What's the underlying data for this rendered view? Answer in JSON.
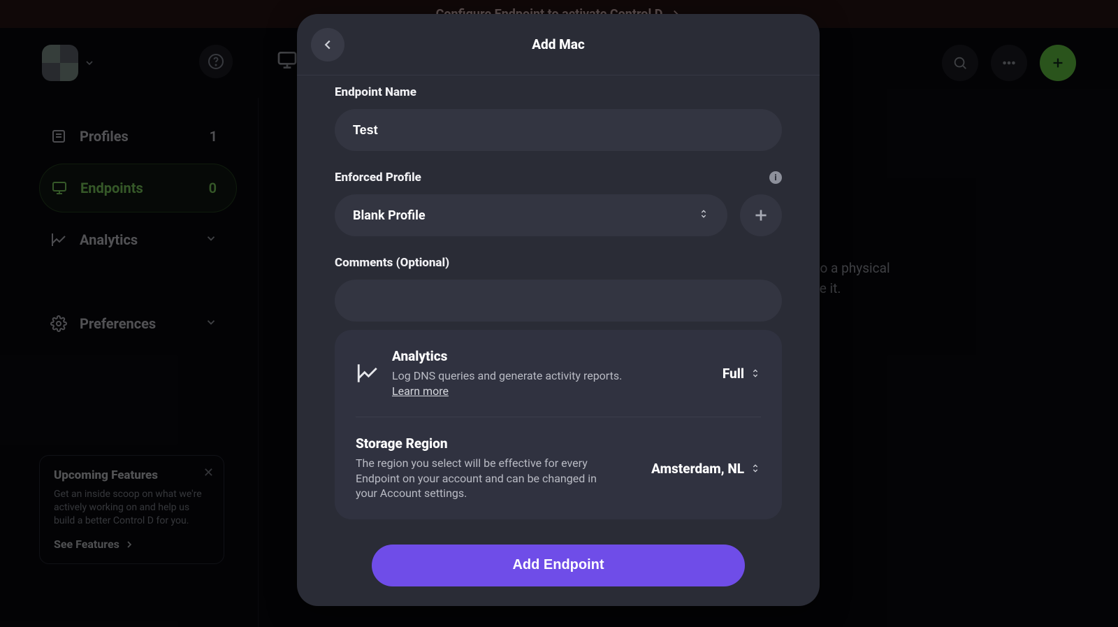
{
  "banner": {
    "text": "Configure Endpoint to activate Control D"
  },
  "sidebar": {
    "items": [
      {
        "label": "Profiles",
        "count": "1"
      },
      {
        "label": "Endpoints",
        "count": "0"
      },
      {
        "label": "Analytics"
      },
      {
        "label": "Preferences"
      }
    ]
  },
  "upcoming": {
    "title": "Upcoming Features",
    "body": "Get an inside scoop on what we're actively working on and help us build a better Control D for you.",
    "cta": "See Features"
  },
  "bg_content": {
    "text": "You have no Endpoints. Add an Endpoint to link to a physical device where you wish to use your Profile it."
  },
  "modal": {
    "title": "Add Mac",
    "endpoint_name_label": "Endpoint Name",
    "endpoint_name_value": "Test",
    "enforced_profile_label": "Enforced Profile",
    "enforced_profile_value": "Blank Profile",
    "comments_label": "Comments (Optional)",
    "comments_value": "",
    "analytics": {
      "title": "Analytics",
      "desc": "Log DNS queries and generate activity reports.",
      "learn": "Learn more",
      "value": "Full"
    },
    "storage": {
      "title": "Storage Region",
      "desc": "The region you select will be effective for every Endpoint on your account and can be changed in your Account settings.",
      "value": "Amsterdam, NL"
    },
    "submit_label": "Add Endpoint"
  }
}
